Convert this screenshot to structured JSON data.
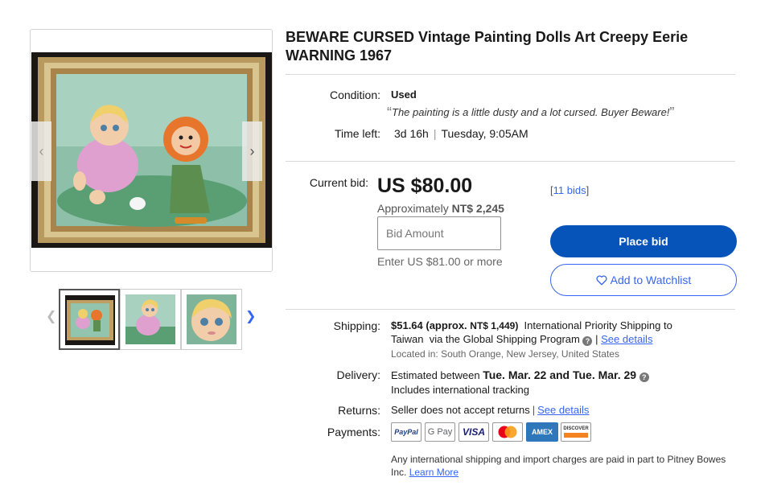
{
  "listing": {
    "title": "BEWARE CURSED Vintage Painting Dolls Art Creepy Eerie WARNING 1967"
  },
  "gallery": {
    "thumbnail_count": 3
  },
  "condition": {
    "label": "Condition:",
    "value": "Used",
    "quote": "The painting is a little dusty and a lot cursed. Buyer Beware!",
    "open_quote": "“",
    "close_quote": "”"
  },
  "time_left": {
    "label": "Time left:",
    "value": "3d 16h",
    "separator": "|",
    "end": "Tuesday, 9:05AM"
  },
  "bid": {
    "label": "Current bid:",
    "price": "US $80.00",
    "approx_prefix": "Approximately",
    "approx_value": "NT$ 2,245",
    "bids_open": "[",
    "bids_link": "11 bids",
    "bids_close": "]",
    "input_placeholder": "Bid Amount",
    "enter_hint": "Enter US $81.00 or more",
    "place_bid": "Place bid",
    "watchlist": "Add to Watchlist"
  },
  "shipping": {
    "label": "Shipping:",
    "cost": "$51.64 (approx.",
    "cost_local": "NT$ 1,449)",
    "method_1": "International Priority Shipping to",
    "method_2": "Taiwan  via the Global Shipping Program",
    "help": "?",
    "separator": "|",
    "see_details": "See details",
    "located_label": "Located in:",
    "located_value": "South Orange, New Jersey, United States"
  },
  "delivery": {
    "label": "Delivery:",
    "prefix": "Estimated between",
    "dates": "Tue. Mar. 22 and Tue. Mar. 29",
    "help": "?",
    "tracking": "Includes international tracking"
  },
  "returns": {
    "label": "Returns:",
    "value": "Seller does not accept returns",
    "separator": "|",
    "see_details": "See details"
  },
  "payments": {
    "label": "Payments:",
    "methods": {
      "paypal": "PayPal",
      "gpay": "G Pay",
      "visa": "VISA",
      "amex": "AMEX",
      "discover": "DISCOVER"
    },
    "disclaimer": "Any international shipping and import charges are paid in part to Pitney Bowes Inc.",
    "learn_more": "Learn More"
  },
  "colors": {
    "accent": "#3665f3",
    "primary_button": "#0654ba"
  }
}
